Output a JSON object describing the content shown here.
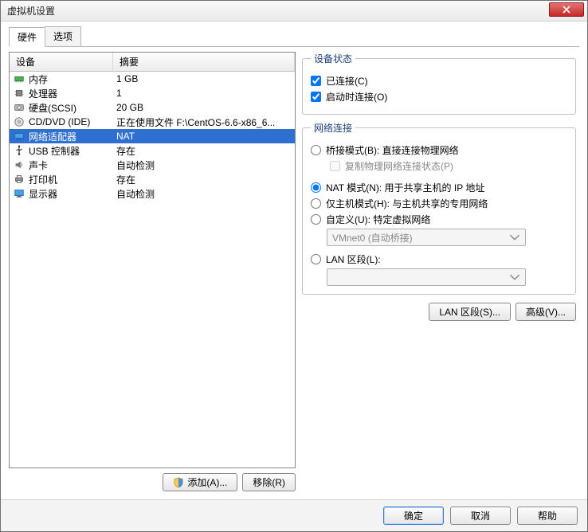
{
  "window": {
    "title": "虚拟机设置"
  },
  "tabs": {
    "hardware": "硬件",
    "options": "选项"
  },
  "list": {
    "col_device": "设备",
    "col_summary": "摘要",
    "rows": [
      {
        "icon": "memory-icon",
        "name": "内存",
        "summary": "1 GB"
      },
      {
        "icon": "cpu-icon",
        "name": "处理器",
        "summary": "1"
      },
      {
        "icon": "hdd-icon",
        "name": "硬盘(SCSI)",
        "summary": "20 GB"
      },
      {
        "icon": "cd-icon",
        "name": "CD/DVD (IDE)",
        "summary": "正在使用文件 F:\\CentOS-6.6-x86_6..."
      },
      {
        "icon": "nic-icon",
        "name": "网络适配器",
        "summary": "NAT"
      },
      {
        "icon": "usb-icon",
        "name": "USB 控制器",
        "summary": "存在"
      },
      {
        "icon": "sound-icon",
        "name": "声卡",
        "summary": "自动检测"
      },
      {
        "icon": "printer-icon",
        "name": "打印机",
        "summary": "存在"
      },
      {
        "icon": "display-icon",
        "name": "显示器",
        "summary": "自动检测"
      }
    ],
    "selected_index": 4
  },
  "left_buttons": {
    "add": "添加(A)...",
    "remove": "移除(R)"
  },
  "device_status": {
    "legend": "设备状态",
    "connected": "已连接(C)",
    "connect_at_power_on": "启动时连接(O)"
  },
  "network": {
    "legend": "网络连接",
    "bridged": "桥接模式(B): 直接连接物理网络",
    "replicate": "复制物理网络连接状态(P)",
    "nat": "NAT 模式(N): 用于共享主机的 IP 地址",
    "hostonly": "仅主机模式(H): 与主机共享的专用网络",
    "custom": "自定义(U): 特定虚拟网络",
    "custom_combo": "VMnet0 (自动桥接)",
    "lan_segment": "LAN 区段(L):",
    "lan_combo": ""
  },
  "right_buttons": {
    "lan_segments": "LAN 区段(S)...",
    "advanced": "高级(V)..."
  },
  "footer": {
    "ok": "确定",
    "cancel": "取消",
    "help": "帮助"
  }
}
